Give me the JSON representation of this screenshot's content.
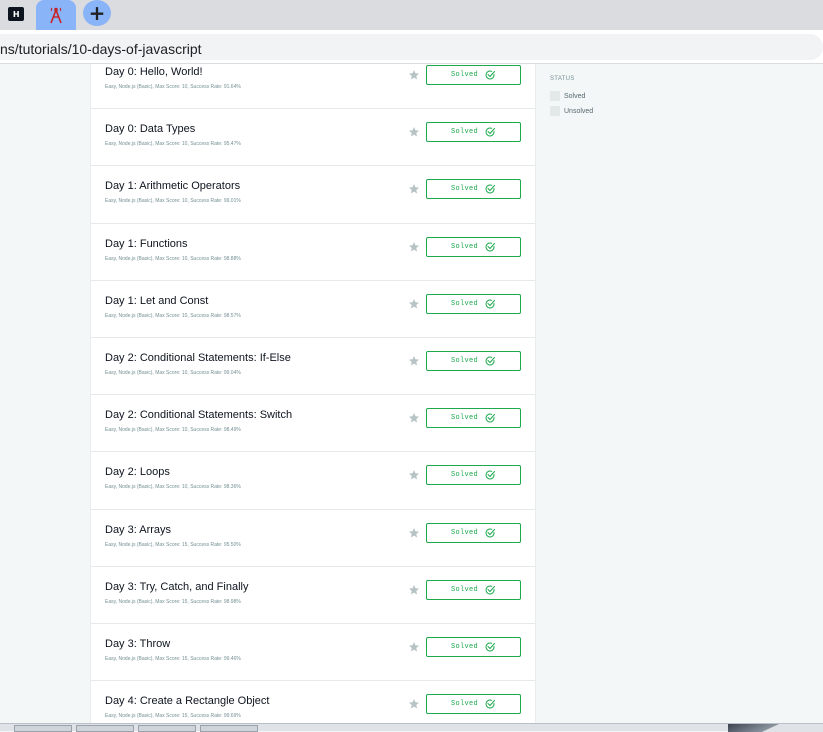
{
  "browser": {
    "url": "ns/tutorials/10-days-of-javascript",
    "newtab_symbol": "+",
    "hr_logo_text": "H",
    "colors": {
      "tab_active": "#8ab4f8",
      "tabbar": "#dadce0"
    }
  },
  "filters": {
    "heading": "STATUS",
    "options": [
      {
        "label": "Solved"
      },
      {
        "label": "Unsolved"
      }
    ]
  },
  "challenges": [
    {
      "title": "Day 0: Hello, World!",
      "meta": "Easy, Node.js (Basic), Max Score: 10, Success Rate: 91.64%",
      "status": "Solved"
    },
    {
      "title": "Day 0: Data Types",
      "meta": "Easy, Node.js (Basic), Max Score: 10, Success Rate: 95.47%",
      "status": "Solved"
    },
    {
      "title": "Day 1: Arithmetic Operators",
      "meta": "Easy, Node.js (Basic), Max Score: 10, Success Rate: 99.01%",
      "status": "Solved"
    },
    {
      "title": "Day 1: Functions",
      "meta": "Easy, Node.js (Basic), Max Score: 10, Success Rate: 98.88%",
      "status": "Solved"
    },
    {
      "title": "Day 1: Let and Const",
      "meta": "Easy, Node.js (Basic), Max Score: 10, Success Rate: 98.57%",
      "status": "Solved"
    },
    {
      "title": "Day 2: Conditional Statements: If-Else",
      "meta": "Easy, Node.js (Basic), Max Score: 10, Success Rate: 99.04%",
      "status": "Solved"
    },
    {
      "title": "Day 2: Conditional Statements: Switch",
      "meta": "Easy, Node.js (Basic), Max Score: 10, Success Rate: 98.49%",
      "status": "Solved"
    },
    {
      "title": "Day 2: Loops",
      "meta": "Easy, Node.js (Basic), Max Score: 10, Success Rate: 98.36%",
      "status": "Solved"
    },
    {
      "title": "Day 3: Arrays",
      "meta": "Easy, Node.js (Basic), Max Score: 15, Success Rate: 95.50%",
      "status": "Solved"
    },
    {
      "title": "Day 3: Try, Catch, and Finally",
      "meta": "Easy, Node.js (Basic), Max Score: 15, Success Rate: 98.98%",
      "status": "Solved"
    },
    {
      "title": "Day 3: Throw",
      "meta": "Easy, Node.js (Basic), Max Score: 15, Success Rate: 99.46%",
      "status": "Solved"
    },
    {
      "title": "Day 4: Create a Rectangle Object",
      "meta": "Easy, Node.js (Basic), Max Score: 15, Success Rate: 99.69%",
      "status": "Solved"
    }
  ],
  "colors": {
    "solved_green": "#1ba94c",
    "page_bg": "#f3f7f7",
    "star_gray": "#b7c3c5"
  },
  "icons": {
    "star": "star-icon",
    "check": "check-circle-icon",
    "tab_favicon": "antenna-tower-icon"
  }
}
